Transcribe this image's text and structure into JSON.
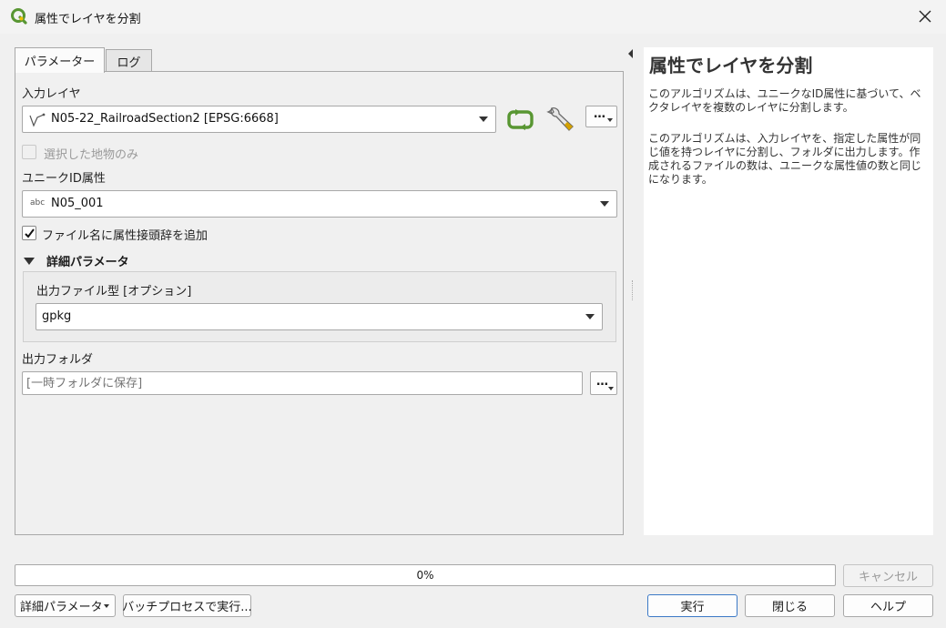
{
  "window": {
    "title": "属性でレイヤを分割"
  },
  "tabs": {
    "parameters": "パラメーター",
    "log": "ログ"
  },
  "params": {
    "input_layer_label": "入力レイヤ",
    "input_layer_value": "N05-22_RailroadSection2 [EPSG:6668]",
    "selected_only_label": "選択した地物のみ",
    "unique_id_label": "ユニークID属性",
    "unique_id_type": "abc",
    "unique_id_value": "N05_001",
    "prefix_label": "ファイル名に属性接頭辞を追加",
    "advanced_label": "詳細パラメータ",
    "output_type_label": "出力ファイル型 [オプション]",
    "output_type_value": "gpkg",
    "output_folder_label": "出力フォルダ",
    "output_folder_placeholder": "[一時フォルダに保存]",
    "ellipsis": "…"
  },
  "help": {
    "title": "属性でレイヤを分割",
    "para1": "このアルゴリズムは、ユニークなID属性に基づいて、ベクタレイヤを複数のレイヤに分割します。",
    "para2": "このアルゴリズムは、入力レイヤを、指定した属性が同じ値を持つレイヤに分割し、フォルダに出力します。作成されるファイルの数は、ユニークな属性値の数と同じになります。"
  },
  "progress": {
    "value": 0,
    "text": "0%"
  },
  "buttons": {
    "cancel": "キャンセル",
    "advanced": "詳細パラメータ",
    "batch": "バッチプロセスで実行...",
    "run": "実行",
    "close": "閉じる",
    "help": "ヘルプ"
  },
  "colors": {
    "accent": "#3b79c6",
    "qgis_green": "#589632",
    "qgis_yellow": "#f0c000"
  }
}
